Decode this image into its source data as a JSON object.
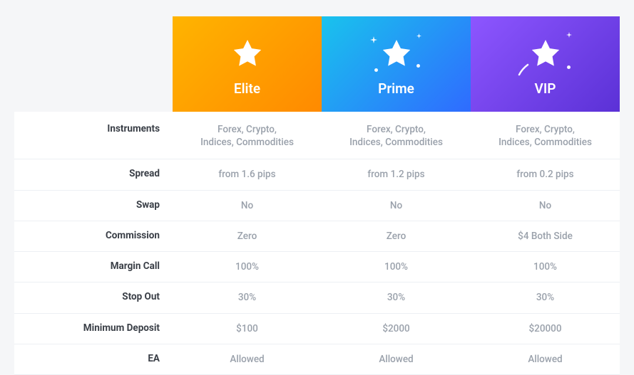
{
  "tiers": [
    {
      "name": "Elite",
      "class": "tier-elite",
      "deco": "none"
    },
    {
      "name": "Prime",
      "class": "tier-prime",
      "deco": "sparkles"
    },
    {
      "name": "VIP",
      "class": "tier-vip",
      "deco": "shooting"
    }
  ],
  "rows": [
    {
      "label": "Instruments",
      "tall": true,
      "values": [
        "Forex, Crypto,\nIndices, Commodities",
        "Forex, Crypto,\nIndices, Commodities",
        "Forex, Crypto,\nIndices, Commodities"
      ]
    },
    {
      "label": "Spread",
      "tall": false,
      "values": [
        "from 1.6 pips",
        "from 1.2 pips",
        "from 0.2 pips"
      ]
    },
    {
      "label": "Swap",
      "tall": false,
      "values": [
        "No",
        "No",
        "No"
      ]
    },
    {
      "label": "Commission",
      "tall": false,
      "values": [
        "Zero",
        "Zero",
        "$4 Both Side"
      ]
    },
    {
      "label": "Margin Call",
      "tall": false,
      "values": [
        "100%",
        "100%",
        "100%"
      ]
    },
    {
      "label": "Stop Out",
      "tall": false,
      "values": [
        "30%",
        "30%",
        "30%"
      ]
    },
    {
      "label": "Minimum Deposit",
      "tall": false,
      "values": [
        "$100",
        "$2000",
        "$20000"
      ]
    },
    {
      "label": "EA",
      "tall": false,
      "values": [
        "Allowed",
        "Allowed",
        "Allowed"
      ]
    }
  ]
}
